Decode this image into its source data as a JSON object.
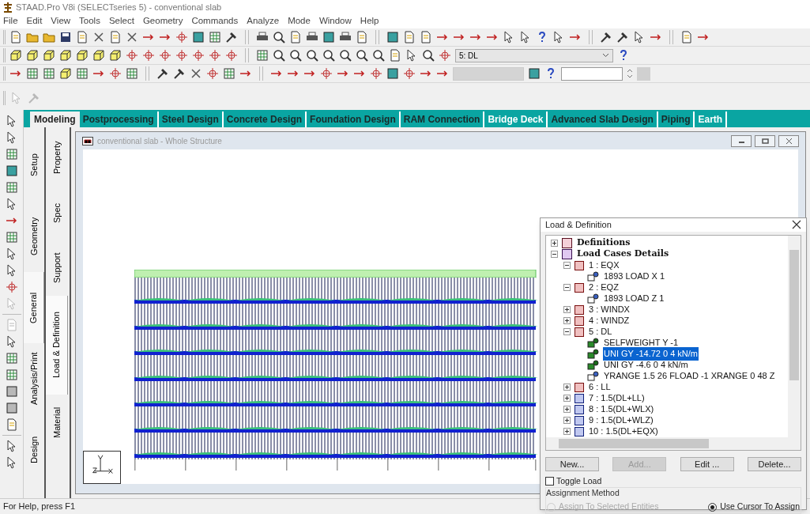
{
  "window": {
    "title": "STAAD.Pro V8i (SELECTseries 5) - conventional slab"
  },
  "menu": [
    "File",
    "Edit",
    "View",
    "Tools",
    "Select",
    "Geometry",
    "Commands",
    "Analyze",
    "Mode",
    "Window",
    "Help"
  ],
  "toolbar": {
    "load_case_dropdown": {
      "value": "5: DL"
    }
  },
  "page_tabs": [
    {
      "label": "Modeling",
      "selected": true,
      "disabled": false
    },
    {
      "label": "Postprocessing",
      "selected": false,
      "disabled": false
    },
    {
      "label": "Steel Design",
      "selected": false,
      "disabled": false
    },
    {
      "label": "Concrete Design",
      "selected": false,
      "disabled": false
    },
    {
      "label": "Foundation Design",
      "selected": false,
      "disabled": false
    },
    {
      "label": "RAM Connection",
      "selected": false,
      "disabled": false
    },
    {
      "label": "Bridge Deck",
      "selected": false,
      "disabled": true
    },
    {
      "label": "Advanced Slab Design",
      "selected": false,
      "disabled": false
    },
    {
      "label": "Piping",
      "selected": false,
      "disabled": false
    },
    {
      "label": "Earth",
      "selected": false,
      "disabled": true
    }
  ],
  "side_tabs": [
    {
      "label": "Setup",
      "selected": false
    },
    {
      "label": "Geometry",
      "selected": false
    },
    {
      "label": "General",
      "selected": true
    },
    {
      "label": "Analysis/Print",
      "selected": false
    },
    {
      "label": "Design",
      "selected": false
    }
  ],
  "sub_tabs": [
    {
      "label": "Property",
      "selected": false
    },
    {
      "label": "Spec",
      "selected": false
    },
    {
      "label": "Support",
      "selected": false
    },
    {
      "label": "Load & Definition",
      "selected": true
    },
    {
      "label": "Material",
      "selected": false
    }
  ],
  "document_window": {
    "title": "conventional slab - Whole Structure"
  },
  "dialog": {
    "title": "Load & Definition",
    "tree": [
      {
        "label": "Definitions",
        "kind": "definitions",
        "expanded": false,
        "selected": false
      },
      {
        "label": "Load Cases Details",
        "kind": "folder",
        "expanded": true,
        "selected": false,
        "children": [
          {
            "label": "1 : EQX",
            "kind": "load",
            "expanded": true,
            "selected": false,
            "children": [
              {
                "label": "1893 LOAD X 1",
                "kind": "outline",
                "selected": false
              }
            ]
          },
          {
            "label": "2 : EQZ",
            "kind": "load",
            "expanded": true,
            "selected": false,
            "children": [
              {
                "label": "1893 LOAD Z 1",
                "kind": "outline",
                "selected": false
              }
            ]
          },
          {
            "label": "3 : WINDX",
            "kind": "load",
            "expanded": false,
            "selected": false
          },
          {
            "label": "4 : WINDZ",
            "kind": "load",
            "expanded": false,
            "selected": false
          },
          {
            "label": "5 : DL",
            "kind": "load",
            "expanded": true,
            "selected": false,
            "children": [
              {
                "label": "SELFWEIGHT Y -1",
                "kind": "solid",
                "selected": false
              },
              {
                "label": "UNI GY -14.72 0 4 kN/m",
                "kind": "solid",
                "selected": true
              },
              {
                "label": "UNI GY -4.6 0 4 kN/m",
                "kind": "solid",
                "selected": false
              },
              {
                "label": "YRANGE 1.5 26 FLOAD -1 XRANGE 0 48  Z",
                "kind": "outline",
                "selected": false
              }
            ]
          },
          {
            "label": "6 : LL",
            "kind": "load",
            "expanded": false,
            "selected": false
          },
          {
            "label": "7 : 1.5(DL+LL)",
            "kind": "combination",
            "expanded": false,
            "selected": false
          },
          {
            "label": "8 : 1.5(DL+WLX)",
            "kind": "combination",
            "expanded": false,
            "selected": false
          },
          {
            "label": "9 : 1.5(DL+WLZ)",
            "kind": "combination",
            "expanded": false,
            "selected": false
          },
          {
            "label": "10 : 1.5(DL+EQX)",
            "kind": "combination",
            "expanded": false,
            "selected": false
          }
        ]
      }
    ],
    "buttons": [
      {
        "label": "New...",
        "disabled": false
      },
      {
        "label": "Add...",
        "disabled": true
      },
      {
        "label": "Edit ...",
        "disabled": false
      },
      {
        "label": "Delete...",
        "disabled": false
      }
    ],
    "toggle_load": {
      "label": "Toggle Load",
      "checked": false
    },
    "assignment_method": {
      "label": "Assignment Method",
      "options": [
        {
          "label": "Assign To Selected Entities",
          "selected": false,
          "disabled": true
        },
        {
          "label": "Use Cursor To Assign",
          "selected": true,
          "disabled": false
        }
      ]
    }
  },
  "status_bar": "For Help, press F1"
}
